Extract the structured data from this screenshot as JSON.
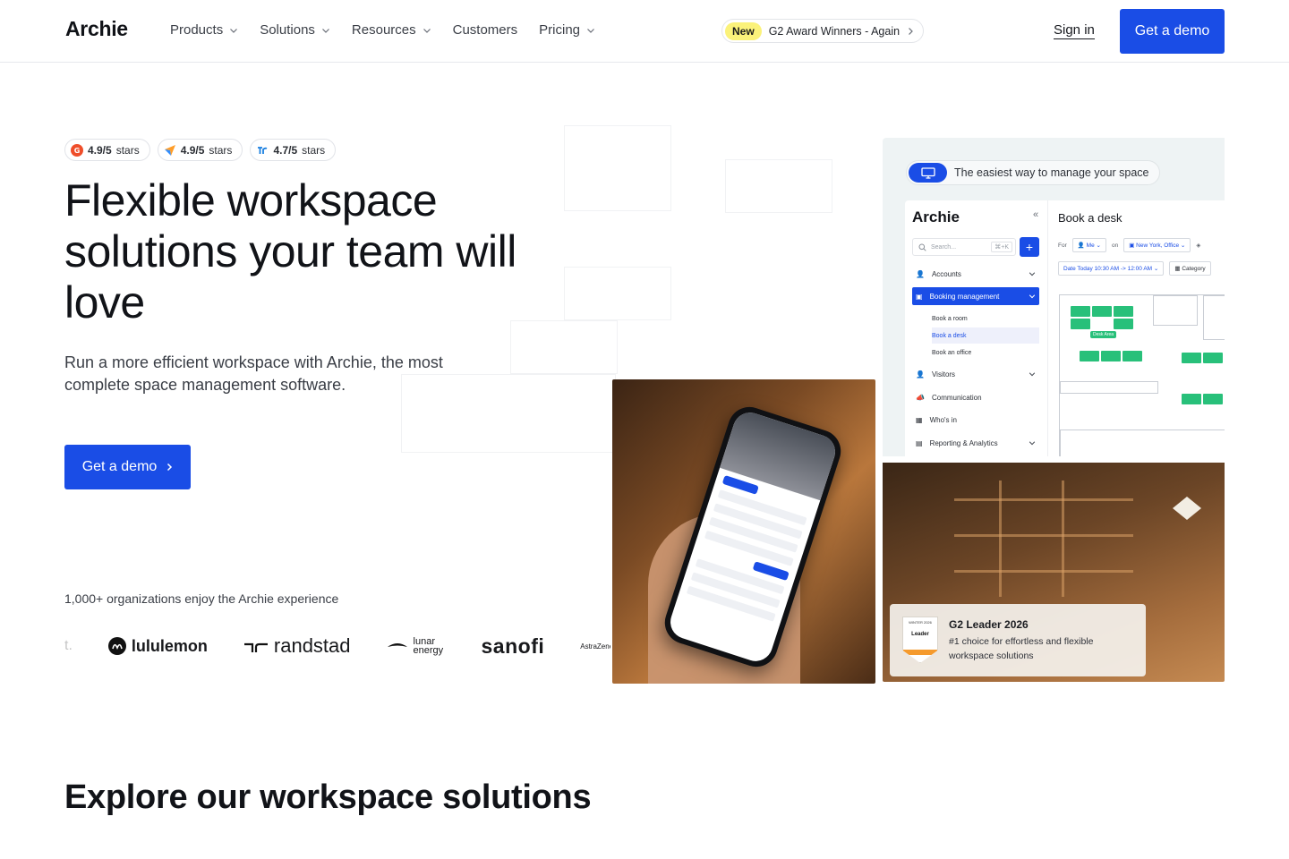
{
  "header": {
    "logo": "Archie",
    "nav": [
      {
        "label": "Products",
        "dropdown": true
      },
      {
        "label": "Solutions",
        "dropdown": true
      },
      {
        "label": "Resources",
        "dropdown": true
      },
      {
        "label": "Customers",
        "dropdown": false
      },
      {
        "label": "Pricing",
        "dropdown": true
      }
    ],
    "award_badge": "New",
    "award_text": "G2 Award Winners - Again",
    "sign_in": "Sign in",
    "cta": "Get a demo"
  },
  "hero": {
    "ratings": [
      {
        "score": "4.9/5",
        "suffix": "stars",
        "icon": "g2-icon"
      },
      {
        "score": "4.9/5",
        "suffix": "stars",
        "icon": "capterra-icon"
      },
      {
        "score": "4.7/5",
        "suffix": "stars",
        "icon": "trustradius-icon"
      }
    ],
    "title": "Flexible workspace solutions your team will love",
    "subtitle": "Run a more efficient workspace with Archie, the most complete space management software.",
    "cta": "Get a demo",
    "orgs_text": "1,000+ organizations enjoy the Archie experience",
    "logos": [
      "t.",
      "lululemon",
      "randstad",
      "lunar energy",
      "sanofi",
      "AstraZeneca"
    ]
  },
  "mockup": {
    "pill_text": "The easiest way to manage your space",
    "app_logo": "Archie",
    "search_placeholder": "Search...",
    "shortcut": "⌘+K",
    "sidebar": [
      {
        "label": "Accounts",
        "icon": "users-icon"
      },
      {
        "label": "Booking management",
        "icon": "calendar-icon",
        "active": true
      },
      {
        "label": "Visitors",
        "icon": "visitor-icon"
      },
      {
        "label": "Communication",
        "icon": "megaphone-icon"
      },
      {
        "label": "Who's in",
        "icon": "building-icon"
      },
      {
        "label": "Reporting & Analytics",
        "icon": "chart-icon"
      }
    ],
    "sub_items": [
      "Book a room",
      "Book a desk",
      "Book an office"
    ],
    "main_title": "Book a desk",
    "filter_for": "For",
    "filter_me": "Me",
    "filter_on": "on",
    "filter_location": "New York, Office",
    "filter_date": "Date  Today 10:30 AM -> 12:00 AM",
    "filter_category": "Category",
    "desk_area_label": "Desk Area"
  },
  "award": {
    "badge_top": "WINTER 2026",
    "badge_label": "Leader",
    "title": "G2 Leader 2026",
    "text": "#1 choice for effortless and flexible workspace solutions"
  },
  "explore_title": "Explore our workspace solutions",
  "colors": {
    "brand": "#1a4de6",
    "badge_yellow": "#fbf27a",
    "desk_green": "#28c07a"
  }
}
